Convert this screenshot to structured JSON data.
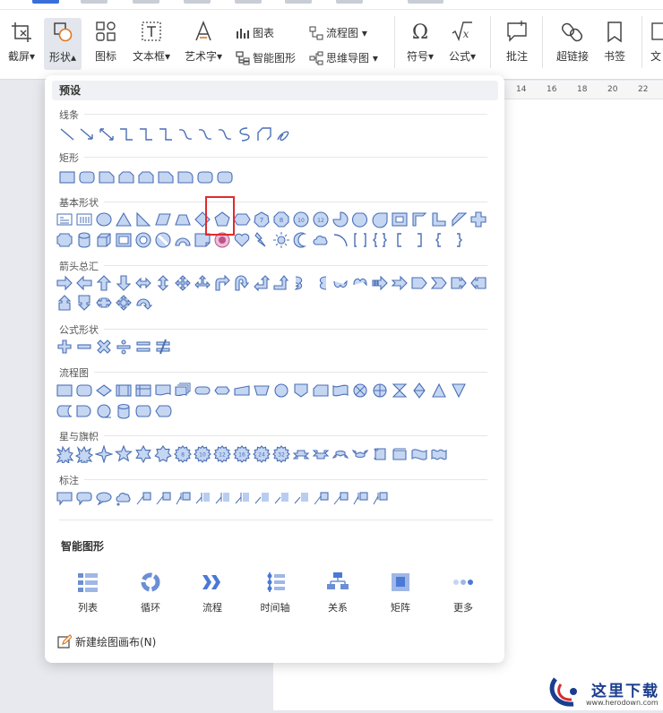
{
  "ribbon": {
    "buttons": [
      {
        "label": "截屏",
        "icon": "screenshot-icon"
      },
      {
        "label": "形状",
        "icon": "shapes-icon"
      },
      {
        "label": "图标",
        "icon": "icons-icon"
      },
      {
        "label": "文本框",
        "icon": "textbox-icon"
      },
      {
        "label": "艺术字",
        "icon": "wordart-icon"
      },
      {
        "label": "符号",
        "icon": "symbol-omega-icon"
      },
      {
        "label": "公式",
        "icon": "formula-sqrt-icon"
      },
      {
        "label": "批注",
        "icon": "comment-icon"
      },
      {
        "label": "超链接",
        "icon": "link-icon"
      },
      {
        "label": "书签",
        "icon": "bookmark-icon"
      },
      {
        "label": "文",
        "icon": "text-icon"
      }
    ],
    "small": {
      "chart": "图表",
      "smartart": "智能图形",
      "flowchart": "流程图",
      "mindmap": "思维导图"
    }
  },
  "ruler": {
    "ticks": [
      "14",
      "16",
      "18",
      "20",
      "22"
    ]
  },
  "panel": {
    "preset": "预设",
    "categories": {
      "lines": "线条",
      "rect": "矩形",
      "basic": "基本形状",
      "arrows": "箭头总汇",
      "equation": "公式形状",
      "flow": "流程图",
      "stars": "星与旗帜",
      "callouts": "标注"
    },
    "star_numbers": [
      "8",
      "10",
      "12",
      "16",
      "24",
      "32"
    ],
    "smart_title": "智能图形",
    "smart_items": [
      {
        "label": "列表",
        "icon": "list-icon"
      },
      {
        "label": "循环",
        "icon": "cycle-icon"
      },
      {
        "label": "流程",
        "icon": "process-icon"
      },
      {
        "label": "时间轴",
        "icon": "timeline-icon"
      },
      {
        "label": "关系",
        "icon": "relationship-icon"
      },
      {
        "label": "矩阵",
        "icon": "matrix-icon"
      },
      {
        "label": "更多",
        "icon": "more-icon"
      }
    ],
    "new_canvas": "新建绘图画布(N)"
  },
  "colors": {
    "shape_fill": "#c5d6f2",
    "shape_stroke": "#4a6fb5",
    "highlight": "#e02b2b",
    "accent": "#3a6fd8"
  },
  "watermark": {
    "text": "这里下载",
    "url": "www.herodown.com"
  }
}
